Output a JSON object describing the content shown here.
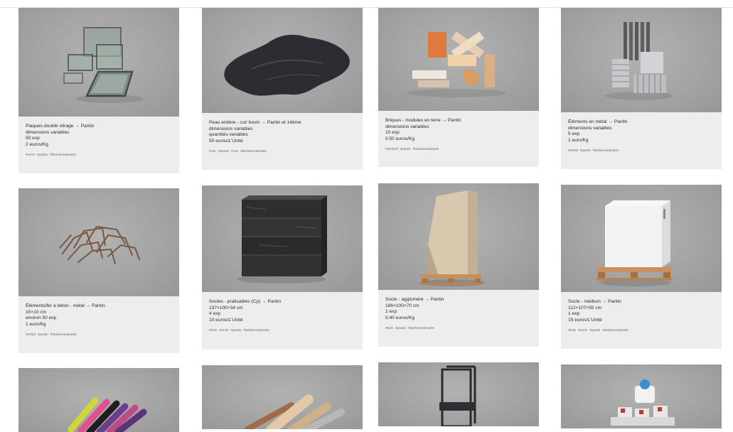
{
  "cards": [
    {
      "title": "Plaques-double vitrage → Pantin",
      "lines": [
        "dimensions variables",
        "50 exp",
        "2 euros/Kg"
      ],
      "tags": [
        "#verre",
        "#pantin",
        "#laréservedesarts"
      ]
    },
    {
      "title": "Peau entière - cuir bovin → Pantin et 14ème",
      "lines": [
        "dimensions variables",
        "quantités variables",
        "50 euros/L'Unité"
      ],
      "tags": [
        "#cuir",
        "#pantin",
        "#14e",
        "#laréservedesarts"
      ]
    },
    {
      "title": "Briques - modules en terre → Pantin",
      "lines": [
        "dimensions variables",
        "10 exp",
        "0.50 euros/Kg"
      ],
      "tags": [
        "#minéral",
        "#pantin",
        "#laréservedesarts"
      ]
    },
    {
      "title": "Éléments en métal → Pantin",
      "lines": [
        "dimensions variables",
        "5 exp",
        "1 euro/Kg"
      ],
      "tags": [
        "#métal",
        "#pantin",
        "#laréservedesarts"
      ]
    },
    {
      "title": "Éléments/fer à béton - métal → Pantin",
      "lines": [
        "15×10 cm",
        "environ 50 exp",
        "1 euro/Kg"
      ],
      "tags": [
        "#métal",
        "#pantin",
        "#laréservedesarts"
      ]
    },
    {
      "title": "Socles - praticables (Cp) → Pantin",
      "lines": [
        "137×100×34 cm",
        "4 exp",
        "10 euros/L'Unité"
      ],
      "tags": [
        "#bois",
        "#socle",
        "#pantin",
        "#laréservedesarts"
      ]
    },
    {
      "title": "Socle - aggloméré → Pantin",
      "lines": [
        "186×100×70 cm",
        "1 exp",
        "0.40 euros/Kg"
      ],
      "tags": [
        "#bois",
        "#pantin",
        "#laréservedesarts"
      ]
    },
    {
      "title": "Socle - médium → Pantin",
      "lines": [
        "112×107×55 cm",
        "1 exp",
        "15 euros/L'Unité"
      ],
      "tags": [
        "#bois",
        "#socle",
        "#pantin",
        "#laréservedesarts"
      ]
    }
  ]
}
